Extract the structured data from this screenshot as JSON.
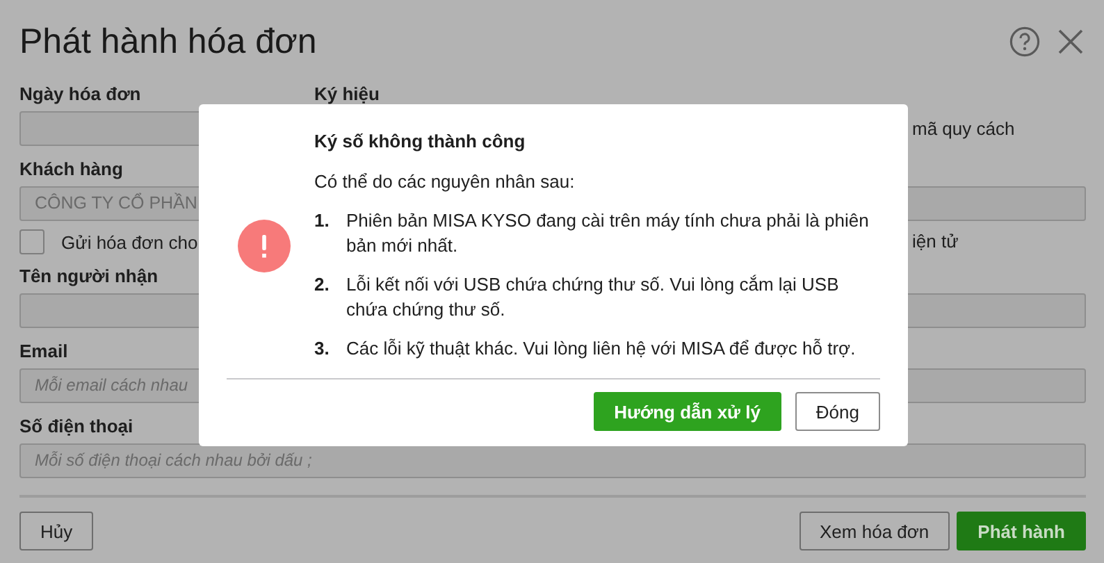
{
  "window": {
    "title": "Phát hành hóa đơn"
  },
  "form": {
    "invoice_date": {
      "label": "Ngày hóa đơn"
    },
    "symbol": {
      "label": "Ký hiệu"
    },
    "spec_option": "mã quy cách",
    "customer": {
      "label": "Khách hàng",
      "value": "CÔNG TY CỔ PHẦN"
    },
    "send_option": {
      "label": "Gửi hóa đơn cho",
      "checked": false
    },
    "electronic_option": "iện tử",
    "recipient": {
      "label": "Tên người nhận"
    },
    "email": {
      "label": "Email",
      "placeholder": "Mỗi email cách nhau"
    },
    "phone": {
      "label": "Số điện thoại",
      "placeholder": "Mỗi số điện thoại cách nhau bởi dấu ;"
    }
  },
  "footer_buttons": [
    {
      "label": "Hủy",
      "kind": "secondary"
    },
    {
      "label": "Xem hóa đơn",
      "kind": "secondary"
    },
    {
      "label": "Phát hành",
      "kind": "primary"
    }
  ],
  "dialog": {
    "title": "Ký số không thành công",
    "intro": "Có thể do các nguyên nhân sau:",
    "reasons": [
      {
        "number": "1.",
        "text": "Phiên bản MISA KYSO đang cài trên máy tính chưa phải là phiên bản mới nhất."
      },
      {
        "number": "2.",
        "text": "Lỗi kết nối với USB chứa chứng thư số. Vui lòng cắm lại USB chứa chứng thư số."
      },
      {
        "number": "3.",
        "text": "Các lỗi kỹ thuật khác. Vui lòng liên hệ với MISA để được hỗ trợ."
      }
    ],
    "buttons": [
      {
        "label": "Hướng dẫn xử lý",
        "kind": "primary"
      },
      {
        "label": "Đóng",
        "kind": "secondary"
      }
    ]
  }
}
